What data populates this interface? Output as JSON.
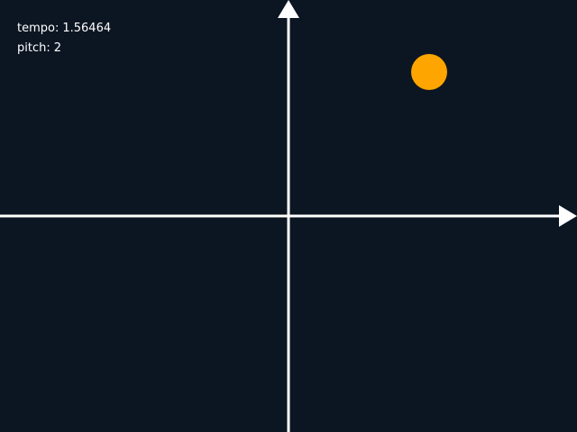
{
  "readout": {
    "tempo_label": "tempo:",
    "tempo_value": "1.56464",
    "pitch_label": "pitch:",
    "pitch_value": "2"
  },
  "colors": {
    "background": "#0c1622",
    "axis": "#ffffff",
    "ball": "#ffa500"
  },
  "icons": {
    "x_axis_arrow": "arrow-right",
    "y_axis_arrow": "arrow-up"
  },
  "ball": {
    "tempo": 1.56464,
    "pitch": 2
  }
}
